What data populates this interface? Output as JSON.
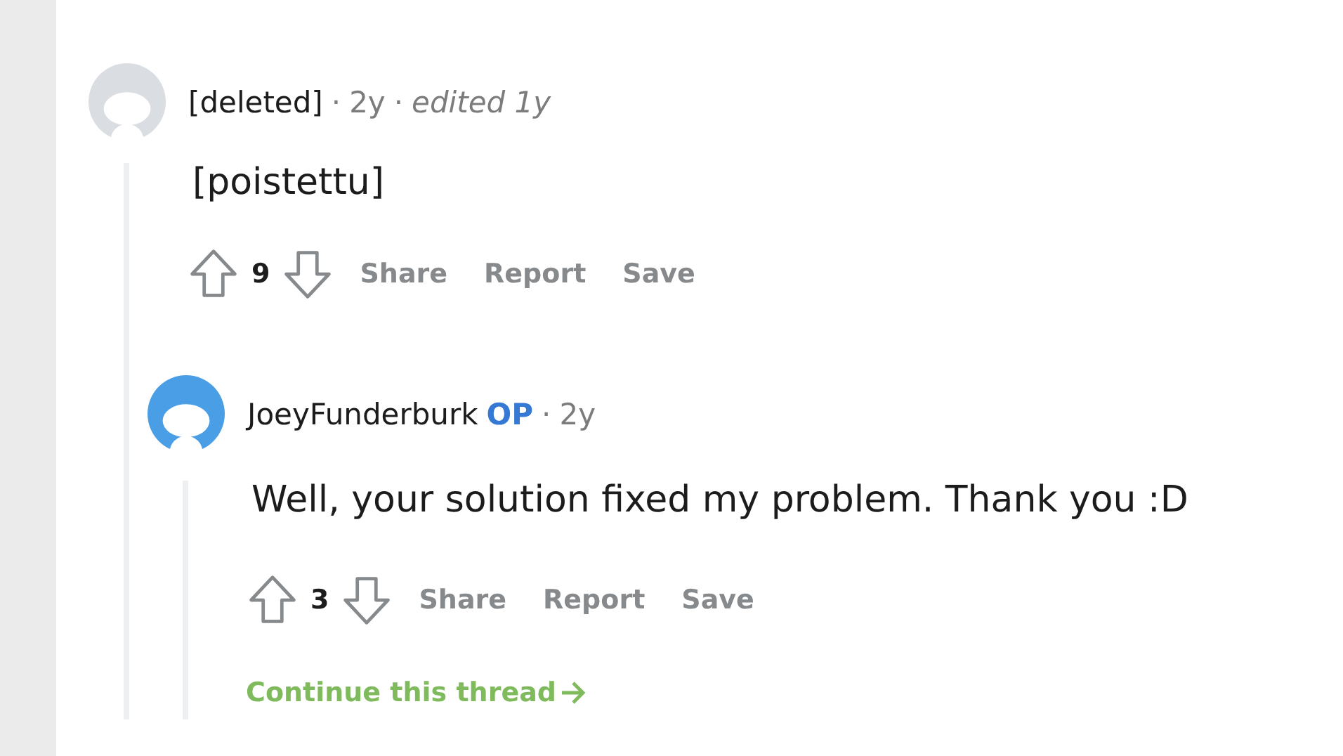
{
  "comments": [
    {
      "kind": "deleted",
      "author": "[deleted]",
      "separator": "·",
      "time": "2y",
      "edited": "edited 1y",
      "body": "[poistettu]",
      "score": "9",
      "actions": [
        "Share",
        "Report",
        "Save"
      ],
      "children": [
        {
          "kind": "user",
          "author": "JoeyFunderburk",
          "op_badge": "OP",
          "separator": "·",
          "time": "2y",
          "body": "Well, your solution fixed my problem. Thank you :D",
          "score": "3",
          "actions": [
            "Share",
            "Report",
            "Save"
          ],
          "continue_link": "Continue this thread"
        }
      ]
    }
  ]
}
